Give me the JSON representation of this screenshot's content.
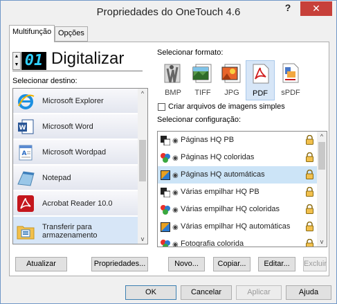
{
  "window": {
    "title": "Propriedades do OneTouch 4.6",
    "help_label": "?",
    "close_label": "✕"
  },
  "tabs": [
    {
      "label": "Multifunção"
    },
    {
      "label": "Opções"
    }
  ],
  "mode": {
    "number": "01",
    "name": "Digitalizar"
  },
  "destination": {
    "label": "Selecionar destino:",
    "items": [
      {
        "label": "Microsoft Explorer",
        "icon": "internet-explorer-icon"
      },
      {
        "label": "Microsoft Word",
        "icon": "word-icon"
      },
      {
        "label": "Microsoft Wordpad",
        "icon": "wordpad-icon"
      },
      {
        "label": "Notepad",
        "icon": "notepad-icon"
      },
      {
        "label": "Acrobat Reader 10.0",
        "icon": "acrobat-icon"
      },
      {
        "label": "Transferir para armazenamento",
        "icon": "storage-folder-icon"
      }
    ],
    "selected_index": 5
  },
  "format": {
    "label": "Selecionar formato:",
    "items": [
      {
        "label": "BMP",
        "icon": "bmp-icon"
      },
      {
        "label": "TIFF",
        "icon": "tiff-icon"
      },
      {
        "label": "JPG",
        "icon": "jpg-icon"
      },
      {
        "label": "PDF",
        "icon": "pdf-icon"
      },
      {
        "label": "sPDF",
        "icon": "spdf-icon"
      }
    ],
    "selected": "PDF"
  },
  "simple_images_checkbox": {
    "label": "Criar arquivos de imagens simples",
    "checked": false
  },
  "configuration": {
    "label": "Selecionar configuração:",
    "items": [
      {
        "label": "Páginas HQ PB",
        "icon": "bw-page-icon"
      },
      {
        "label": "Páginas HQ coloridas",
        "icon": "color-page-icon"
      },
      {
        "label": "Páginas HQ automáticas",
        "icon": "auto-page-icon"
      },
      {
        "label": "Várias empilhar HQ PB",
        "icon": "bw-page-icon"
      },
      {
        "label": "Várias empilhar HQ coloridas",
        "icon": "color-page-icon"
      },
      {
        "label": "Várias empilhar HQ automáticas",
        "icon": "auto-page-icon"
      },
      {
        "label": "Fotografia colorida",
        "icon": "color-page-icon"
      }
    ],
    "selected_index": 2
  },
  "action_buttons": {
    "update": "Atualizar",
    "properties": "Propriedades...",
    "new": "Novo...",
    "copy": "Copiar...",
    "edit": "Editar...",
    "delete": "Excluir"
  },
  "dialog_buttons": {
    "ok": "OK",
    "cancel": "Cancelar",
    "apply": "Aplicar",
    "help": "Ajuda"
  },
  "colors": {
    "selection": "#cce4f7",
    "close": "#c7403a",
    "lcd_text": "#2fd0ff"
  }
}
